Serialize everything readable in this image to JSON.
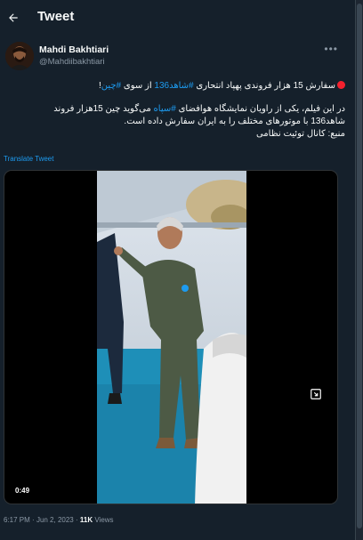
{
  "header": {
    "title": "Tweet",
    "back_icon": "arrow-left-icon"
  },
  "author": {
    "name": "Mahdi Bakhtiari",
    "handle": "@Mahdiibakhtiari",
    "more_icon": "more-horizontal-icon"
  },
  "tweet": {
    "line1_text": "سفارش 15 هزار فروندی پهپاد انتحاری ",
    "line1_hashtag1": "#شاهد136",
    "line1_mid": " از سوی ",
    "line1_hashtag2": "#چین",
    "line1_end": "!",
    "line2_text": "در این فیلم، یکی از راویان نمایشگاه هوافضای ",
    "line2_hashtag": "#سپاه",
    "line2_end": " می‌گوید چین 15هزار فروند",
    "line3": "شاهد136 با موتورهای مختلف را به ایران سفارش داده است.",
    "line4": "منبع: کانال توئیت نظامی",
    "translate_label": "Translate Tweet"
  },
  "media": {
    "duration": "0:49",
    "expand_icon": "expand-icon"
  },
  "meta": {
    "time": "6:17 PM",
    "separator": "·",
    "date": "Jun 2, 2023",
    "views_count": "11K",
    "views_label": "Views"
  },
  "colors": {
    "background": "#15202b",
    "accent": "#1d9bf0",
    "muted": "#8b98a5",
    "red": "#f4212e"
  }
}
